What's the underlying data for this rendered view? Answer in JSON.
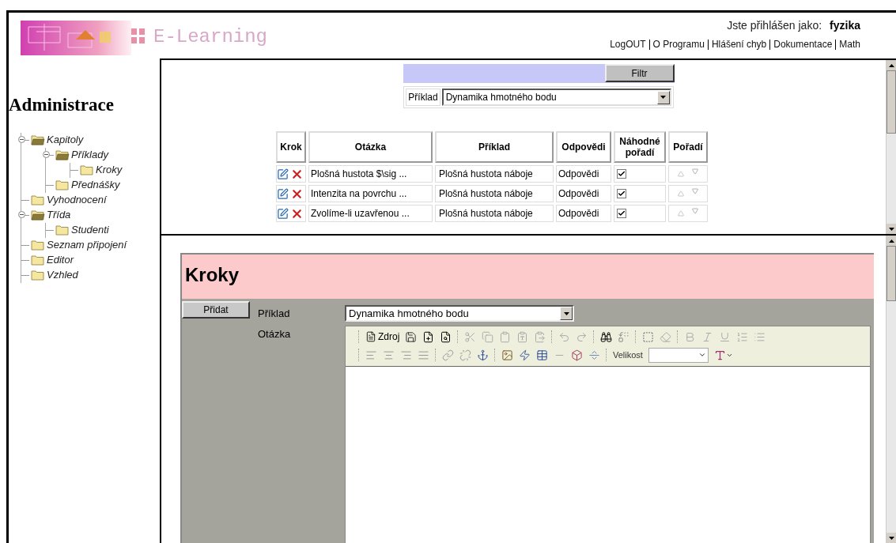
{
  "header": {
    "app_title": "E-Learning",
    "login_label": "Jste přihlášen jako:",
    "username": "fyzika",
    "links": [
      "LogOUT",
      "O Programu",
      "Hlášení chyb",
      "Dokumentace",
      "Math"
    ]
  },
  "sidebar": {
    "title": "Administrace",
    "tree": [
      {
        "label": "Kapitoly",
        "expanded": true,
        "children": [
          {
            "label": "Příklady",
            "expanded": true,
            "children": [
              {
                "label": "Kroky"
              }
            ]
          },
          {
            "label": "Přednášky"
          }
        ]
      },
      {
        "label": "Vyhodnocení"
      },
      {
        "label": "Třída",
        "expanded": true,
        "children": [
          {
            "label": "Studenti"
          }
        ]
      },
      {
        "label": "Seznam připojení"
      },
      {
        "label": "Editor"
      },
      {
        "label": "Vzhled"
      }
    ]
  },
  "filter": {
    "button": "Filtr",
    "field_label": "Příklad",
    "value": "Dynamika hmotného bodu"
  },
  "table": {
    "columns": [
      "Krok",
      "Otázka",
      "Příklad",
      "Odpovědi",
      "Náhodné pořadí",
      "Pořadí"
    ],
    "rows": [
      {
        "question": "Plošná hustota $\\sig ...",
        "example": "Plošná hustota náboje",
        "answers": "Odpovědi",
        "random_order": true
      },
      {
        "question": "Intenzita na povrchu ...",
        "example": "Plošná hustota náboje",
        "answers": "Odpovědi",
        "random_order": true
      },
      {
        "question": "Zvolíme-li uzavřenou ...",
        "example": "Plošná hustota náboje",
        "answers": "Odpovědi",
        "random_order": true
      }
    ]
  },
  "form": {
    "title": "Kroky",
    "add_button": "Přidat",
    "fields": [
      {
        "label": "Příklad",
        "value": "Dynamika hmotného bodu"
      },
      {
        "label": "Otázka"
      }
    ],
    "editor": {
      "source_label": "Zdroj",
      "size_label": "Velikost"
    }
  }
}
